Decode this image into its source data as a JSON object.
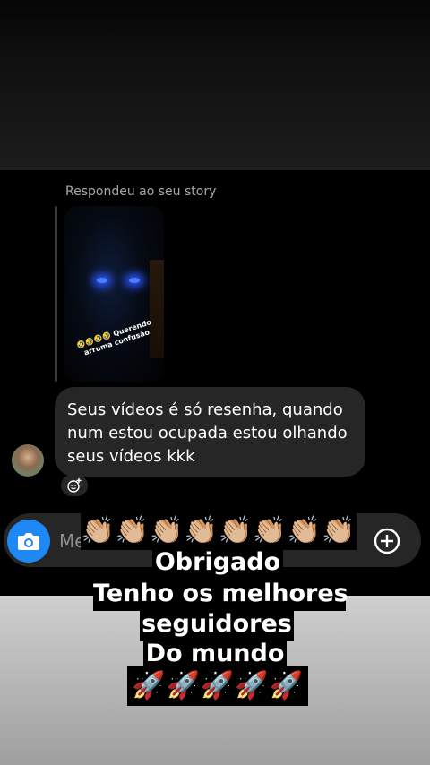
{
  "story_reply": {
    "caption": "Respondeu ao seu story",
    "story_text": "🤣🤣🤣🤣 Querendo arruma confusão"
  },
  "message": {
    "text": "Seus vídeos é só resenha,  quando num estou ocupada estou olhando seus vídeos kkk"
  },
  "composer": {
    "placeholder": "Me"
  },
  "icons": {
    "camera": "camera-icon",
    "add": "plus-circle-icon",
    "react": "add-reaction-icon"
  },
  "overlay": {
    "emoji_row": "👏🏼👏🏼👏🏼👏🏼👏🏼👏🏼👏🏼👏🏼",
    "line1": "Obrigado",
    "line2": "Tenho os melhores",
    "line3": "seguidores",
    "line4": "Do mundo",
    "rockets": "🚀🚀🚀🚀🚀"
  },
  "colors": {
    "accent": "#1e88f5",
    "bubble": "#262626",
    "background": "#000000"
  }
}
